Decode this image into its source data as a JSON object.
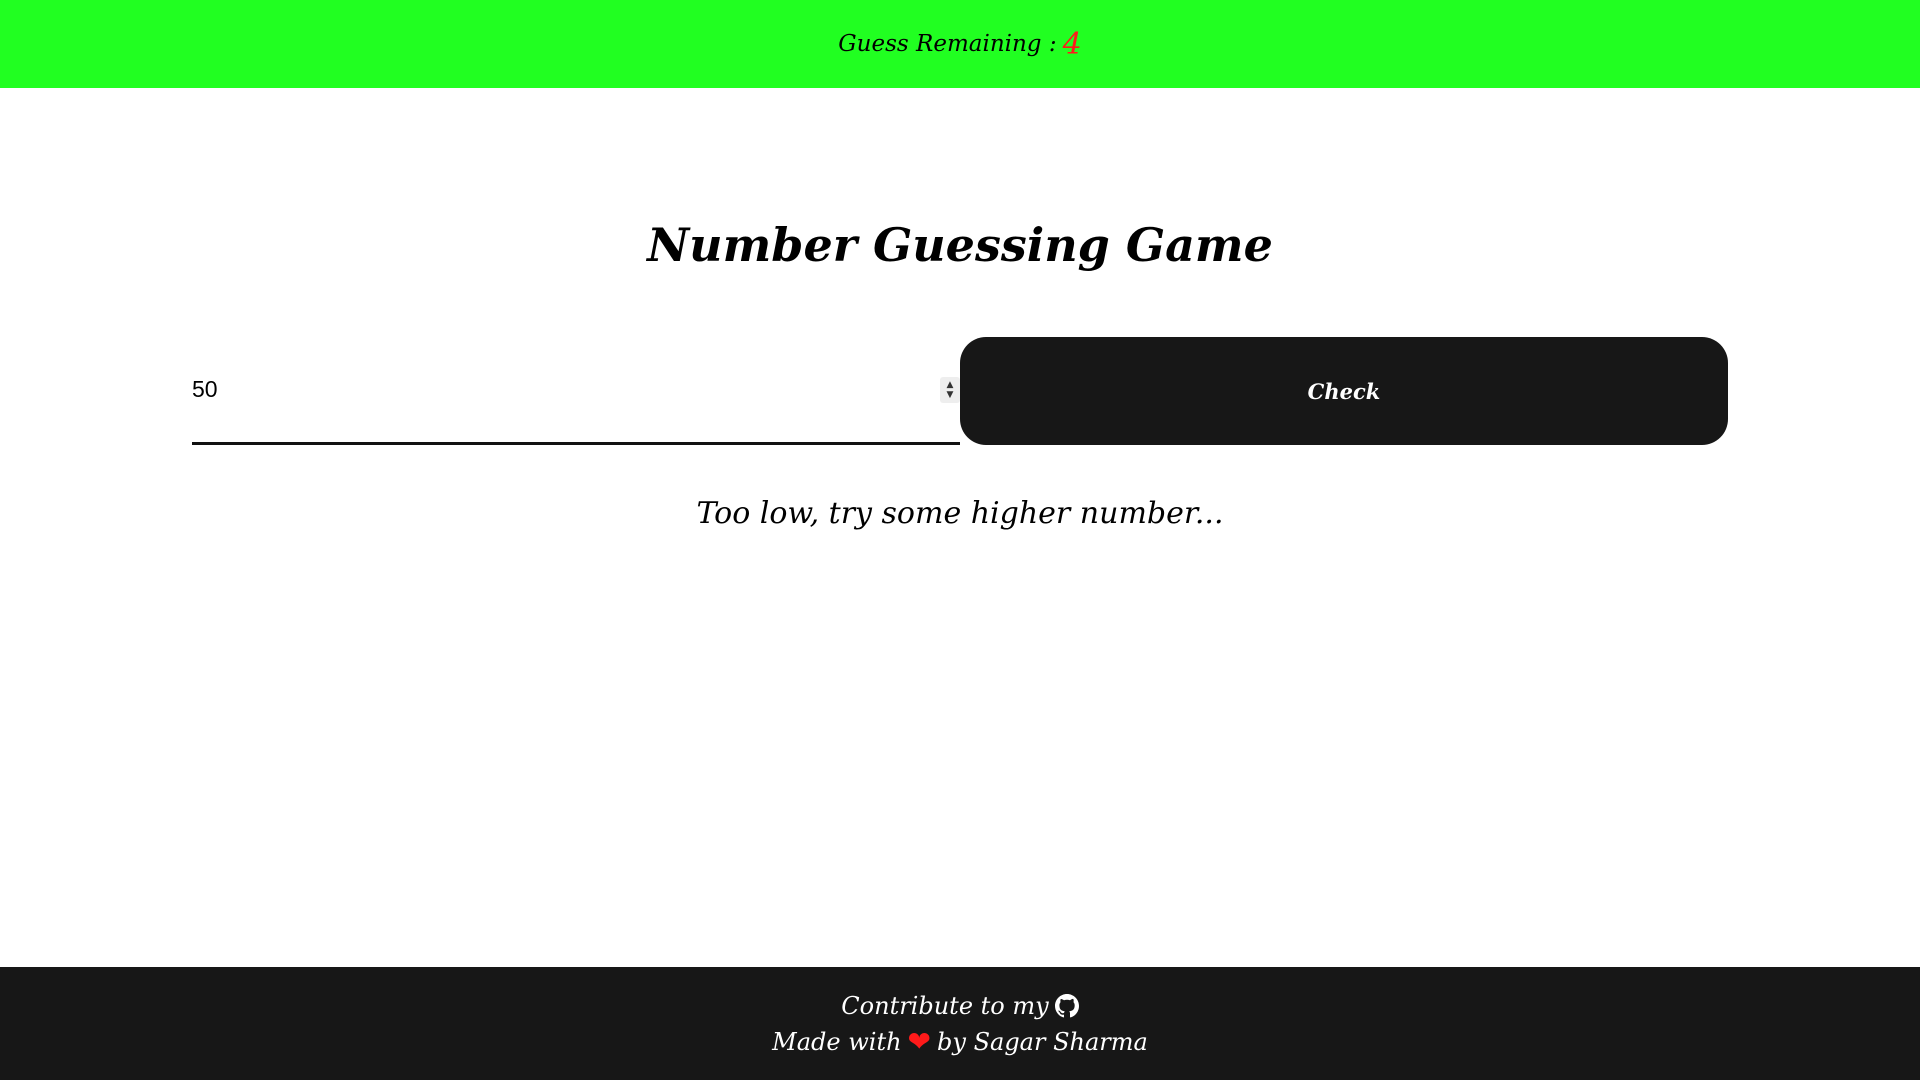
{
  "topbar": {
    "label": "Guess Remaining :",
    "remaining": "4",
    "background": "#21ff21",
    "count_color": "#ff1a1a"
  },
  "title": "Number Guessing Game",
  "guess": {
    "value": "50",
    "check_label": "Check"
  },
  "message": "Too low, try some higher number...",
  "footer": {
    "contribute_text": "Contribute to my",
    "github_icon": "github-icon",
    "made_with": "Made with",
    "heart_icon": "heart-icon",
    "by_text": "by Sagar Sharma"
  }
}
